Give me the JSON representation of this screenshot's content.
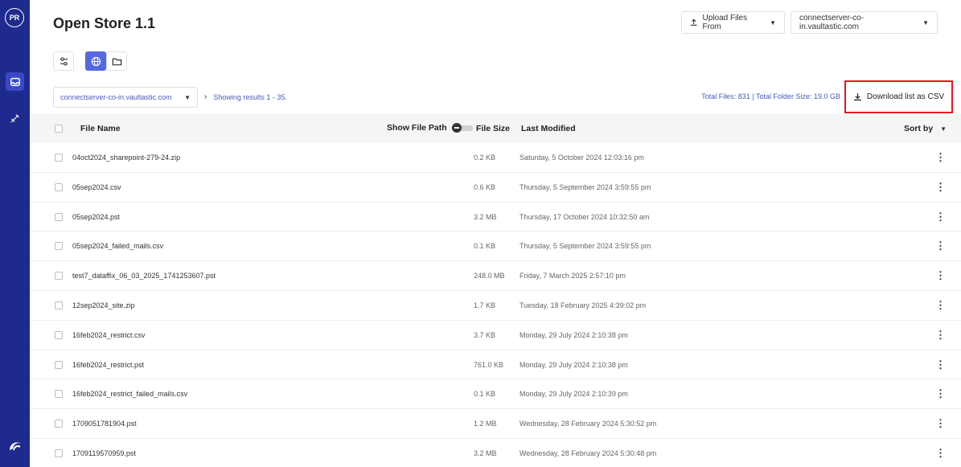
{
  "sidebar": {
    "avatar_initials": "PR"
  },
  "header": {
    "title": "Open Store 1.1",
    "upload_label": "Upload Files From",
    "server_label": "connectserver-co-in.vaultastic.com"
  },
  "filter": {
    "server_select": "connectserver-co-in.vaultastic.com",
    "showing_text": "Showing results 1 - 35.",
    "totals_text": "Total Files: 831  |  Total Folder Size: 19.0 GB",
    "download_csv_label": "Download list as CSV"
  },
  "table": {
    "headers": {
      "file_name": "File Name",
      "show_path": "Show File Path",
      "file_size": "File Size",
      "last_modified": "Last Modified",
      "sort_by": "Sort by"
    },
    "rows": [
      {
        "name": "04oct2024_sharepoint-279-24.zip",
        "size": "0.2 KB",
        "modified": "Saturday, 5 October 2024 12:03:16 pm"
      },
      {
        "name": "05sep2024.csv",
        "size": "0.6 KB",
        "modified": "Thursday, 5 September 2024 3:59:55 pm"
      },
      {
        "name": "05sep2024.pst",
        "size": "3.2 MB",
        "modified": "Thursday, 17 October 2024 10:32:50 am"
      },
      {
        "name": "05sep2024_failed_mails.csv",
        "size": "0.1 KB",
        "modified": "Thursday, 5 September 2024 3:59:55 pm"
      },
      {
        "name": "test7_dataffix_06_03_2025_1741253607.pst",
        "size": "248.0 MB",
        "modified": "Friday, 7 March 2025 2:57:10 pm"
      },
      {
        "name": "12sep2024_site.zip",
        "size": "1.7 KB",
        "modified": "Tuesday, 18 February 2025 4:39:02 pm"
      },
      {
        "name": "16feb2024_restrict.csv",
        "size": "3.7 KB",
        "modified": "Monday, 29 July 2024 2:10:38 pm"
      },
      {
        "name": "16feb2024_restrict.pst",
        "size": "761.0 KB",
        "modified": "Monday, 29 July 2024 2:10:38 pm"
      },
      {
        "name": "16feb2024_restrict_failed_mails.csv",
        "size": "0.1 KB",
        "modified": "Monday, 29 July 2024 2:10:39 pm"
      },
      {
        "name": "1709051781904.pst",
        "size": "1.2 MB",
        "modified": "Wednesday, 28 February 2024 5:30:52 pm"
      },
      {
        "name": "1709119570959.pst",
        "size": "3.2 MB",
        "modified": "Wednesday, 28 February 2024 5:30:48 pm"
      }
    ]
  },
  "colors": {
    "sidebar": "#1e2a8e",
    "accent": "#5468e0",
    "highlight_border": "#e8141b"
  }
}
